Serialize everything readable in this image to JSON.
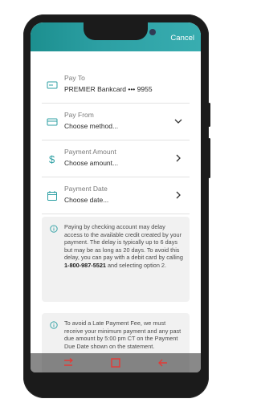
{
  "header": {
    "cancel_label": "Cancel",
    "accent_color": "#2c9fa3"
  },
  "form": {
    "pay_to": {
      "label": "Pay To",
      "value": "PREMIER Bankcard ••• 9955",
      "icon": "card-icon"
    },
    "pay_from": {
      "label": "Pay From",
      "value": "Choose method...",
      "icon": "card-icon"
    },
    "payment_amount": {
      "label": "Payment Amount",
      "value": "Choose amount...",
      "icon": "dollar-icon"
    },
    "payment_date": {
      "label": "Payment Date",
      "value": "Choose date...",
      "icon": "calendar-icon"
    }
  },
  "notices": {
    "delay_text": "Paying by checking account may delay access to the available credit created by your payment. The delay is typically up to 6 days but may be as long as 20 days. To avoid this delay, you can pay with a debit card by calling",
    "phone_number": "1-800-987-5521",
    "delay_suffix": "and selecting option 2.",
    "late_fee_text": "To avoid a Late Payment Fee, we must receive your minimum payment and any past due amount by 5:00 pm CT on the Payment Due Date shown on the statement."
  }
}
